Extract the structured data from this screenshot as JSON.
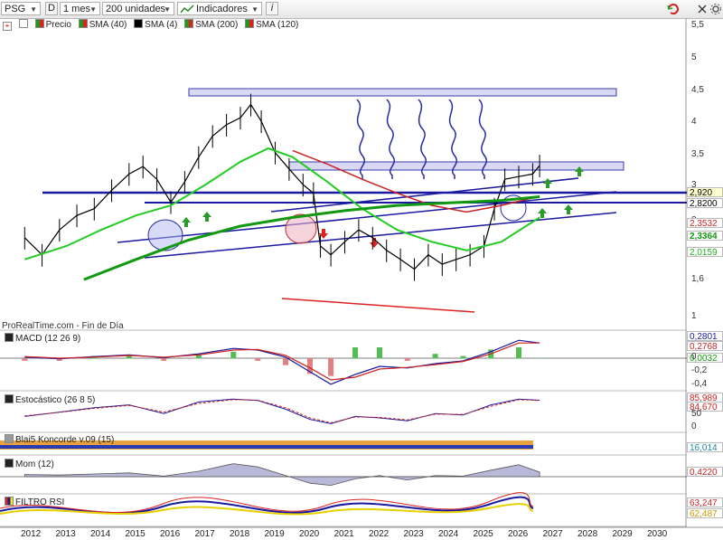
{
  "toolbar": {
    "symbol": "PSG",
    "d_label": "D",
    "interval": "1 mes",
    "units": "200 unidades",
    "indicators": "Indicadores",
    "info": "i"
  },
  "legend": {
    "price": "Precio",
    "sma40": "SMA (40)",
    "sma4": "SMA (4)",
    "sma200": "SMA (200)",
    "sma120": "SMA (120)"
  },
  "watermark": "ProRealTime.com - Fin de Día",
  "panels": {
    "macd": "MACD (12 26 9)",
    "stoch": "Estocástico (26 8 5)",
    "koncorde": "Blai5 Koncorde v.09 (15)",
    "mom": "Mom (12)",
    "rsi": "FILTRO RSI"
  },
  "price_axis": [
    "5,5",
    "5",
    "4,5",
    "4",
    "3,5",
    "3",
    "2",
    "1,6",
    "1"
  ],
  "macd_axis": [
    "0",
    "-0,2",
    "-0,4"
  ],
  "stoch_axis": [
    "50",
    "0"
  ],
  "value_tags": {
    "price_last": "2,920",
    "line_a": "2,8200",
    "sma120": "2,3532",
    "sma200": "2,3364",
    "sma40": "2,0159",
    "macd1": "0,2801",
    "macd2": "0,2768",
    "macd3": "0,0032",
    "stoch1": "85,989",
    "stoch2": "84,670",
    "koncorde": "16,014",
    "mom": "0,4220",
    "rsi1": "63,247",
    "rsi2": "62,487"
  },
  "colors": {
    "price": "#000000",
    "sma40": "#22cc22",
    "sma4": "#000000",
    "sma200": "#119911",
    "sma120": "#cc2222",
    "trend": "#1a1aa0"
  },
  "chart_data": {
    "type": "line",
    "x_axis_labels": [
      "2012",
      "2013",
      "2014",
      "2015",
      "2016",
      "2017",
      "2018",
      "2019",
      "2020",
      "2021",
      "2022",
      "2023",
      "2024",
      "2025",
      "2026",
      "2027",
      "2028",
      "2029",
      "2030"
    ],
    "y_axis": "log",
    "ylim": [
      0.9,
      5.6
    ],
    "series": [
      {
        "name": "Precio",
        "x": [
          2011.8,
          2012.3,
          2012.8,
          2013.3,
          2013.8,
          2014.3,
          2014.8,
          2015.2,
          2015.6,
          2016.0,
          2016.4,
          2016.8,
          2017.2,
          2017.6,
          2018.0,
          2018.3,
          2018.6,
          2019.0,
          2019.4,
          2019.8,
          2020.1,
          2020.3,
          2020.6,
          2021.0,
          2021.4,
          2021.8,
          2022.2,
          2022.6,
          2023.0,
          2023.4,
          2023.8,
          2024.2,
          2024.6,
          2025.0,
          2025.3,
          2025.6,
          2026.0,
          2026.4,
          2026.6
        ],
        "values": [
          1.75,
          1.55,
          1.85,
          2.05,
          2.15,
          2.45,
          2.75,
          2.9,
          2.65,
          2.25,
          2.6,
          3.1,
          3.6,
          3.9,
          4.1,
          4.5,
          4.0,
          3.2,
          2.85,
          2.55,
          2.4,
          1.65,
          1.55,
          1.7,
          1.85,
          1.75,
          1.6,
          1.5,
          1.4,
          1.55,
          1.45,
          1.5,
          1.55,
          1.65,
          2.15,
          2.65,
          2.7,
          2.75,
          2.92
        ]
      },
      {
        "name": "SMA (40)",
        "x": [
          2011.8,
          2013.0,
          2014.0,
          2015.0,
          2016.0,
          2017.0,
          2018.0,
          2018.8,
          2019.5,
          2020.5,
          2021.5,
          2022.5,
          2023.5,
          2024.5,
          2025.5,
          2026.6
        ],
        "values": [
          1.5,
          1.65,
          1.85,
          2.05,
          2.2,
          2.55,
          3.0,
          3.3,
          3.1,
          2.6,
          2.15,
          1.85,
          1.7,
          1.6,
          1.7,
          2.02
        ]
      },
      {
        "name": "SMA (120)",
        "x": [
          2019.5,
          2020.5,
          2021.5,
          2022.5,
          2023.5,
          2024.5,
          2025.5,
          2026.6
        ],
        "values": [
          3.25,
          2.95,
          2.65,
          2.4,
          2.2,
          2.1,
          2.2,
          2.35
        ]
      },
      {
        "name": "SMA (200)",
        "x": [
          2013.5,
          2015.0,
          2016.5,
          2018.0,
          2019.5,
          2021.0,
          2022.5,
          2024.0,
          2025.5,
          2026.6
        ],
        "values": [
          1.3,
          1.5,
          1.72,
          1.9,
          2.02,
          2.12,
          2.2,
          2.24,
          2.28,
          2.34
        ]
      }
    ],
    "macd": {
      "x": [
        2011.8,
        2012.8,
        2013.8,
        2014.8,
        2015.8,
        2016.8,
        2017.8,
        2018.5,
        2019.3,
        2020.0,
        2020.6,
        2021.3,
        2022.0,
        2022.8,
        2023.6,
        2024.4,
        2025.2,
        2026.0,
        2026.6
      ],
      "macd": [
        0.02,
        -0.01,
        0.03,
        0.06,
        0.01,
        0.08,
        0.18,
        0.15,
        0.02,
        -0.25,
        -0.48,
        -0.3,
        -0.15,
        -0.18,
        -0.1,
        -0.05,
        0.12,
        0.33,
        0.28
      ],
      "signal": [
        0.03,
        0.0,
        0.02,
        0.05,
        0.02,
        0.06,
        0.15,
        0.16,
        0.05,
        -0.18,
        -0.4,
        -0.35,
        -0.2,
        -0.17,
        -0.12,
        -0.06,
        0.08,
        0.28,
        0.28
      ]
    },
    "stoch": {
      "x": [
        2011.8,
        2012.8,
        2013.8,
        2014.8,
        2015.8,
        2016.8,
        2017.8,
        2018.5,
        2019.3,
        2020.0,
        2020.6,
        2021.3,
        2022.0,
        2022.8,
        2023.6,
        2024.4,
        2025.2,
        2026.0,
        2026.6
      ],
      "k": [
        30,
        45,
        60,
        70,
        40,
        80,
        90,
        85,
        55,
        20,
        5,
        30,
        25,
        15,
        40,
        35,
        70,
        90,
        86
      ],
      "d": [
        32,
        44,
        58,
        68,
        45,
        75,
        88,
        86,
        60,
        25,
        8,
        28,
        27,
        18,
        38,
        37,
        65,
        88,
        85
      ]
    },
    "mom": {
      "x": [
        2011.8,
        2012.8,
        2013.8,
        2014.8,
        2015.8,
        2016.8,
        2017.8,
        2018.5,
        2019.3,
        2020.0,
        2020.6,
        2021.3,
        2022.0,
        2022.8,
        2023.6,
        2024.4,
        2025.2,
        2026.0,
        2026.6
      ],
      "values": [
        0.2,
        0.15,
        0.25,
        0.35,
        0.05,
        0.5,
        1.2,
        0.9,
        0.1,
        -0.6,
        -0.8,
        -0.2,
        0.1,
        -0.3,
        0.1,
        0.05,
        0.6,
        1.1,
        0.42
      ]
    }
  }
}
